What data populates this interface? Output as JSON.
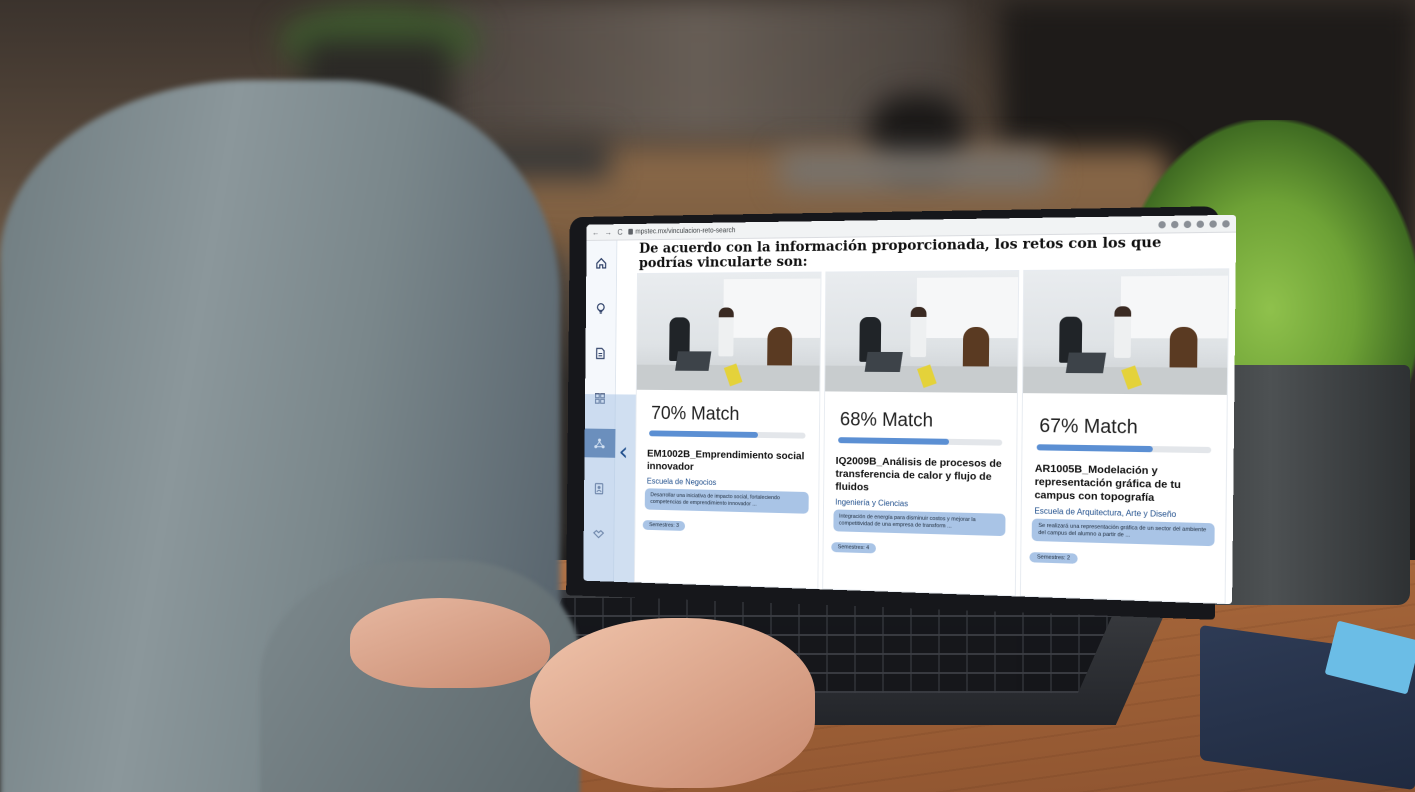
{
  "browser": {
    "url": "mpstec.mx/vinculacion-reto-search",
    "back": "←",
    "forward": "→",
    "reload": "C"
  },
  "sidebar": {
    "items": [
      {
        "icon": "home-icon"
      },
      {
        "icon": "lightbulb-icon"
      },
      {
        "icon": "document-icon"
      },
      {
        "icon": "grid-icon"
      },
      {
        "icon": "network-icon",
        "active": true
      },
      {
        "icon": "contacts-icon"
      },
      {
        "icon": "handshake-icon"
      }
    ]
  },
  "main": {
    "heading": "De acuerdo con la información proporcionada, los retos con los que podrías vincularte son:",
    "back_icon": "‹"
  },
  "cards": [
    {
      "match_label": "70% Match",
      "match_fraction": 0.7,
      "code": "EM1002B_Emprendimiento social innovador",
      "school": "Escuela de Negocios",
      "description": "Desarrollar una iniciativa de impacto social, fortaleciendo competencias de emprendimiento innovador ...",
      "semester": "Semestres: 3"
    },
    {
      "match_label": "68% Match",
      "match_fraction": 0.68,
      "code": "IQ2009B_Análisis de procesos de transferencia de calor y flujo de fluidos",
      "school": "Ingeniería y Ciencias",
      "description": "Integración de energía para disminuir costos y mejorar la competitividad de una empresa de transform ...",
      "semester": "Semestres: 4"
    },
    {
      "match_label": "67% Match",
      "match_fraction": 0.67,
      "code": "AR1005B_Modelación y representación gráfica de tu campus con topografía",
      "school": "Escuela de Arquitectura, Arte y Diseño",
      "description": "Se realizará una representación gráfica de un sector del ambiente del campus del alumno a partir de ...",
      "semester": "Semestres: 2"
    }
  ],
  "colors": {
    "accent": "#1f4e8c",
    "pill": "#a9c4e6",
    "progress": "#5b8fd3"
  }
}
